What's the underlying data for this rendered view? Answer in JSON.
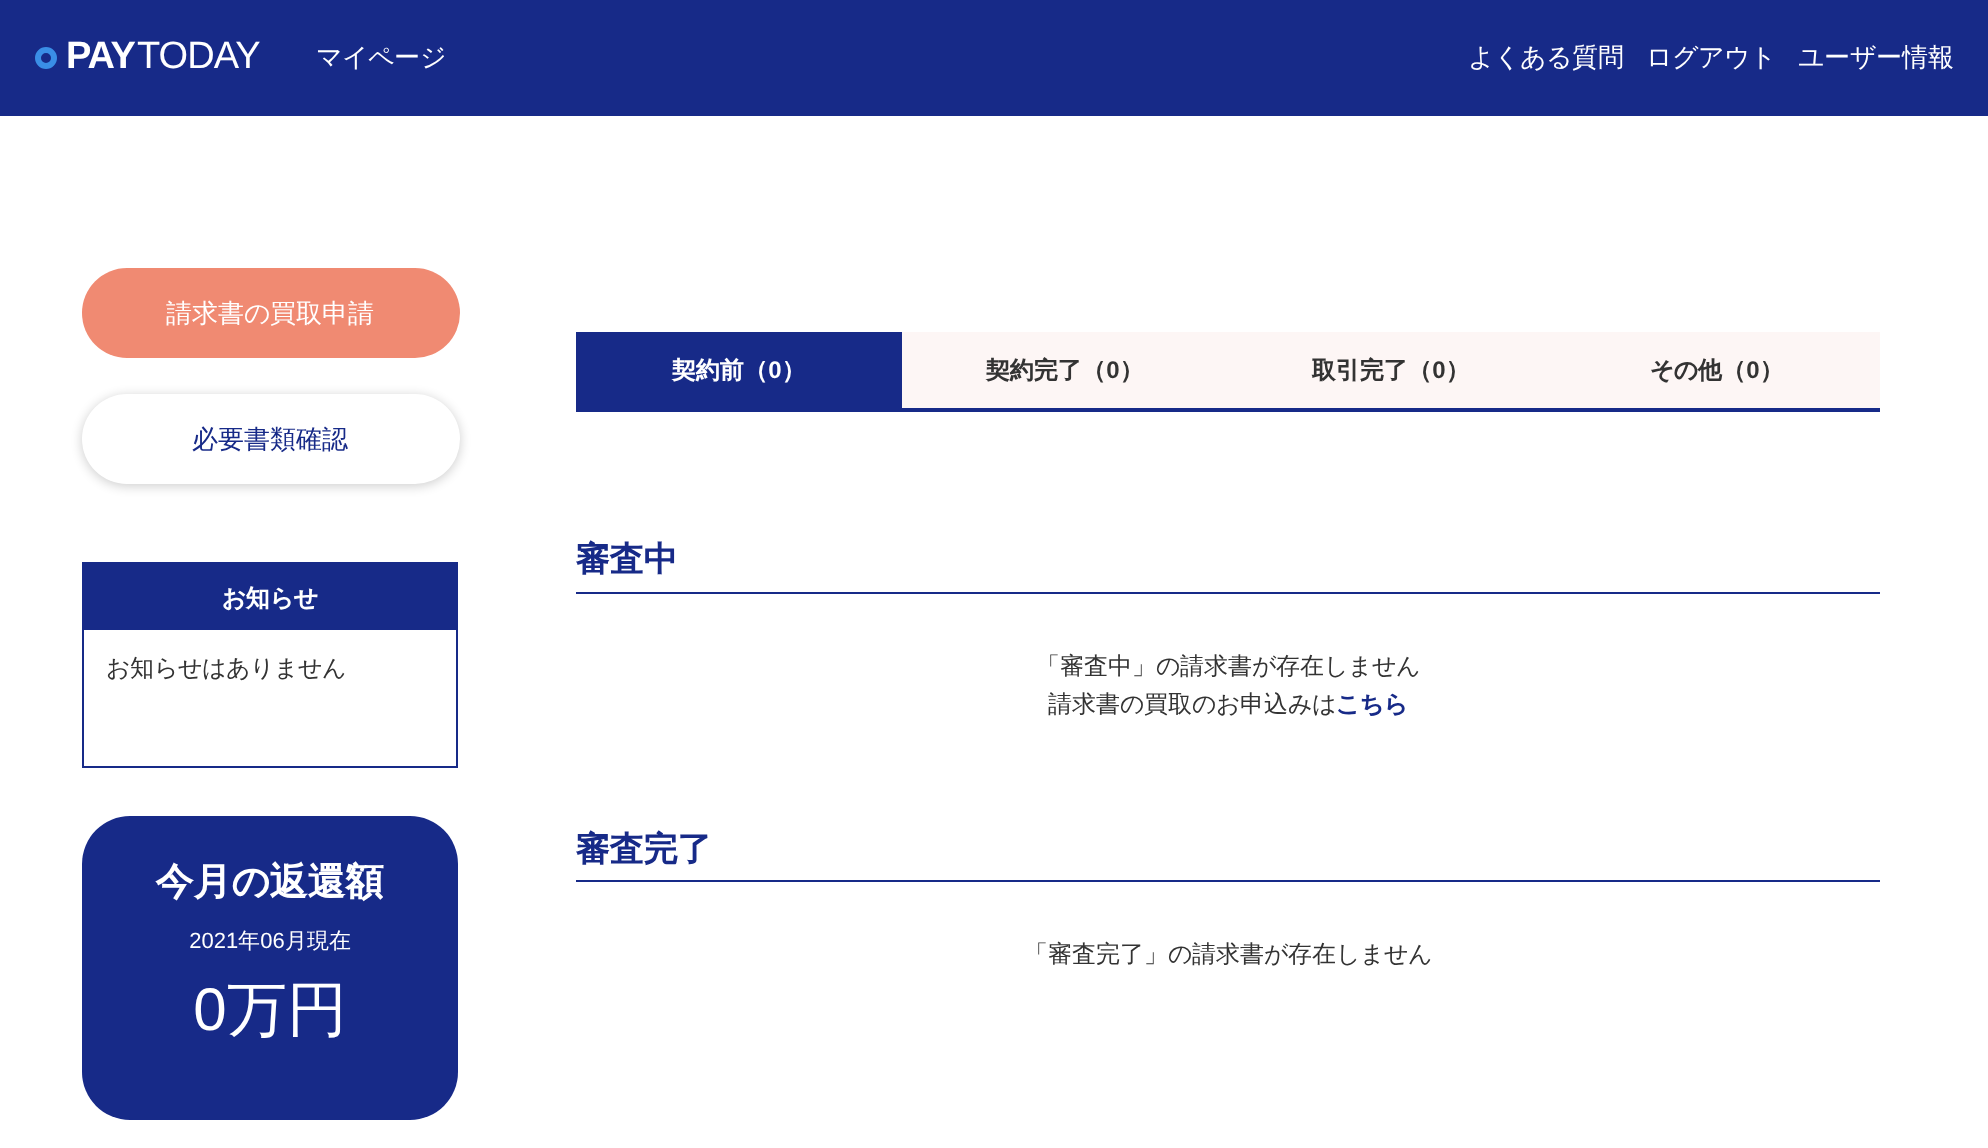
{
  "header": {
    "logo": {
      "bold": "PAY",
      "light": "TODAY"
    },
    "nav_left": "マイページ",
    "nav_right": [
      "よくある質問",
      "ログアウト",
      "ユーザー情報"
    ]
  },
  "sidebar": {
    "buttons": [
      {
        "label": "請求書の買取申請",
        "kind": "primary"
      },
      {
        "label": "必要書類確認",
        "kind": "secondary"
      }
    ],
    "notice": {
      "title": "お知らせ",
      "body": "お知らせはありません"
    },
    "repayment": {
      "title": "今月の返還額",
      "date": "2021年06月現在",
      "amount": "0万円"
    }
  },
  "tabs": [
    {
      "label": "契約前（0）",
      "selected": true
    },
    {
      "label": "契約完了（0）",
      "selected": false
    },
    {
      "label": "取引完了（0）",
      "selected": false
    },
    {
      "label": "その他（0）",
      "selected": false
    }
  ],
  "sections": [
    {
      "title": "審査中",
      "message": "「審査中」の請求書が存在しません",
      "link_prefix": "請求書の買取のお申込みは",
      "link": "こちら"
    },
    {
      "title": "審査完了",
      "message": "「審査完了」の請求書が存在しません"
    }
  ]
}
